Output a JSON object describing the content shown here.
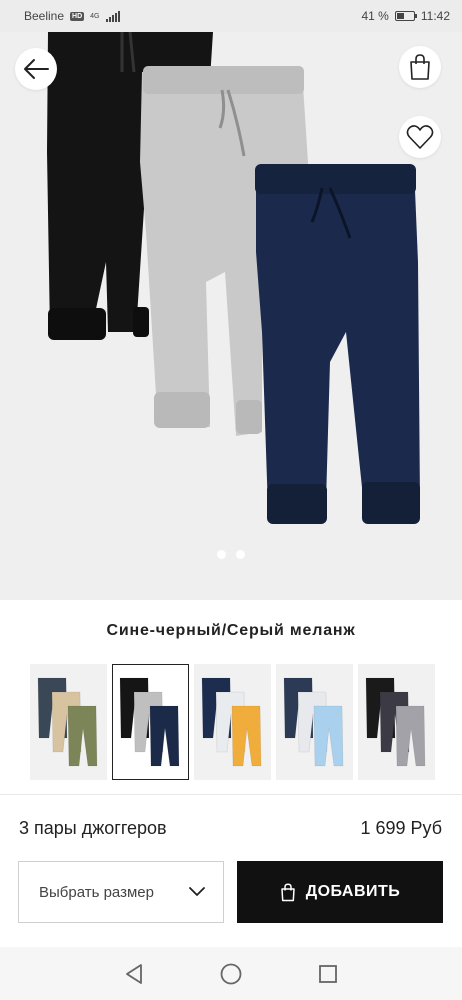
{
  "status_bar": {
    "carrier": "Beeline",
    "network_badge": "HD",
    "network_type": "4G",
    "battery": "41 %",
    "time": "11:42"
  },
  "icons": {
    "back": "arrow-left-icon",
    "bag": "shopping-bag-icon",
    "favorite": "heart-icon",
    "dropdown": "chevron-down-icon",
    "nav_back": "triangle-back-icon",
    "nav_home": "circle-home-icon",
    "nav_recents": "square-recents-icon"
  },
  "gallery": {
    "current_index": 1,
    "total": 2
  },
  "product": {
    "color_name": "Сине-черный/Серый меланж",
    "name": "3 пары джоггеров",
    "price": "1 699 Руб"
  },
  "swatches": [
    {
      "colors": [
        "#3a4757",
        "#d7c3a0",
        "#7c8558"
      ],
      "selected": false
    },
    {
      "colors": [
        "#151515",
        "#bfbfbf",
        "#1c2a4a"
      ],
      "selected": true
    },
    {
      "colors": [
        "#1d2d50",
        "#e9ecef",
        "#f1ad3b"
      ],
      "selected": false
    },
    {
      "colors": [
        "#2c3a55",
        "#e7e9ec",
        "#a9d1ee"
      ],
      "selected": false
    },
    {
      "colors": [
        "#1a1a1a",
        "#3c3a44",
        "#a2a2a8"
      ],
      "selected": false
    }
  ],
  "actions": {
    "size_placeholder": "Выбрать размер",
    "add_label": "ДОБАВИТЬ"
  },
  "colors": {
    "primary_button": "#111111",
    "hero_background": "#efefef"
  }
}
